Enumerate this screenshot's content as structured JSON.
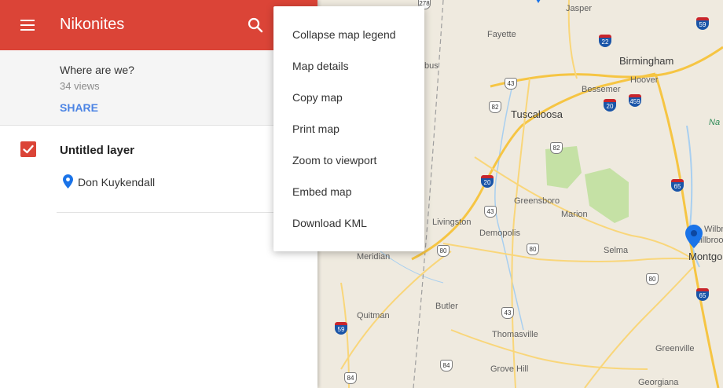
{
  "header": {
    "title": "Nikonites",
    "menu_icon": "menu-icon",
    "search_icon": "search-icon",
    "background": "#db4437"
  },
  "map_info": {
    "description": "Where are we?",
    "views": "34 views",
    "share_label": "SHARE"
  },
  "layer": {
    "title": "Untitled layer",
    "checked": true,
    "items": [
      {
        "name": "Don Kuykendall",
        "icon": "place-pin-icon"
      }
    ]
  },
  "dropdown": {
    "items": [
      "Collapse map legend",
      "Map details",
      "Copy map",
      "Print map",
      "Zoom to viewport",
      "Embed map",
      "Download KML"
    ]
  },
  "map": {
    "cities": [
      "Jasper",
      "Fayette",
      "Birmingham",
      "Hoover",
      "Bessemer",
      "bus",
      "Tuscaloosa",
      "Greensboro",
      "Marion",
      "Livingston",
      "Demopolis",
      "Selma",
      "Meridian",
      "Butler",
      "Quitman",
      "Thomasville",
      "Grove Hill",
      "Greenville",
      "Georgiana",
      "Montgo",
      "Millbroo",
      "Wilbro",
      "Na"
    ],
    "highways": [
      "278",
      "22",
      "59",
      "43",
      "20",
      "459",
      "82",
      "82",
      "20",
      "65",
      "43",
      "80",
      "80",
      "80",
      "59",
      "43",
      "65",
      "84",
      "84"
    ],
    "colors": {
      "land": "#efeadf",
      "road": "#f6c543",
      "water": "#a8cff0",
      "park": "#c5e1a5",
      "marker": "#1a73e8"
    }
  }
}
